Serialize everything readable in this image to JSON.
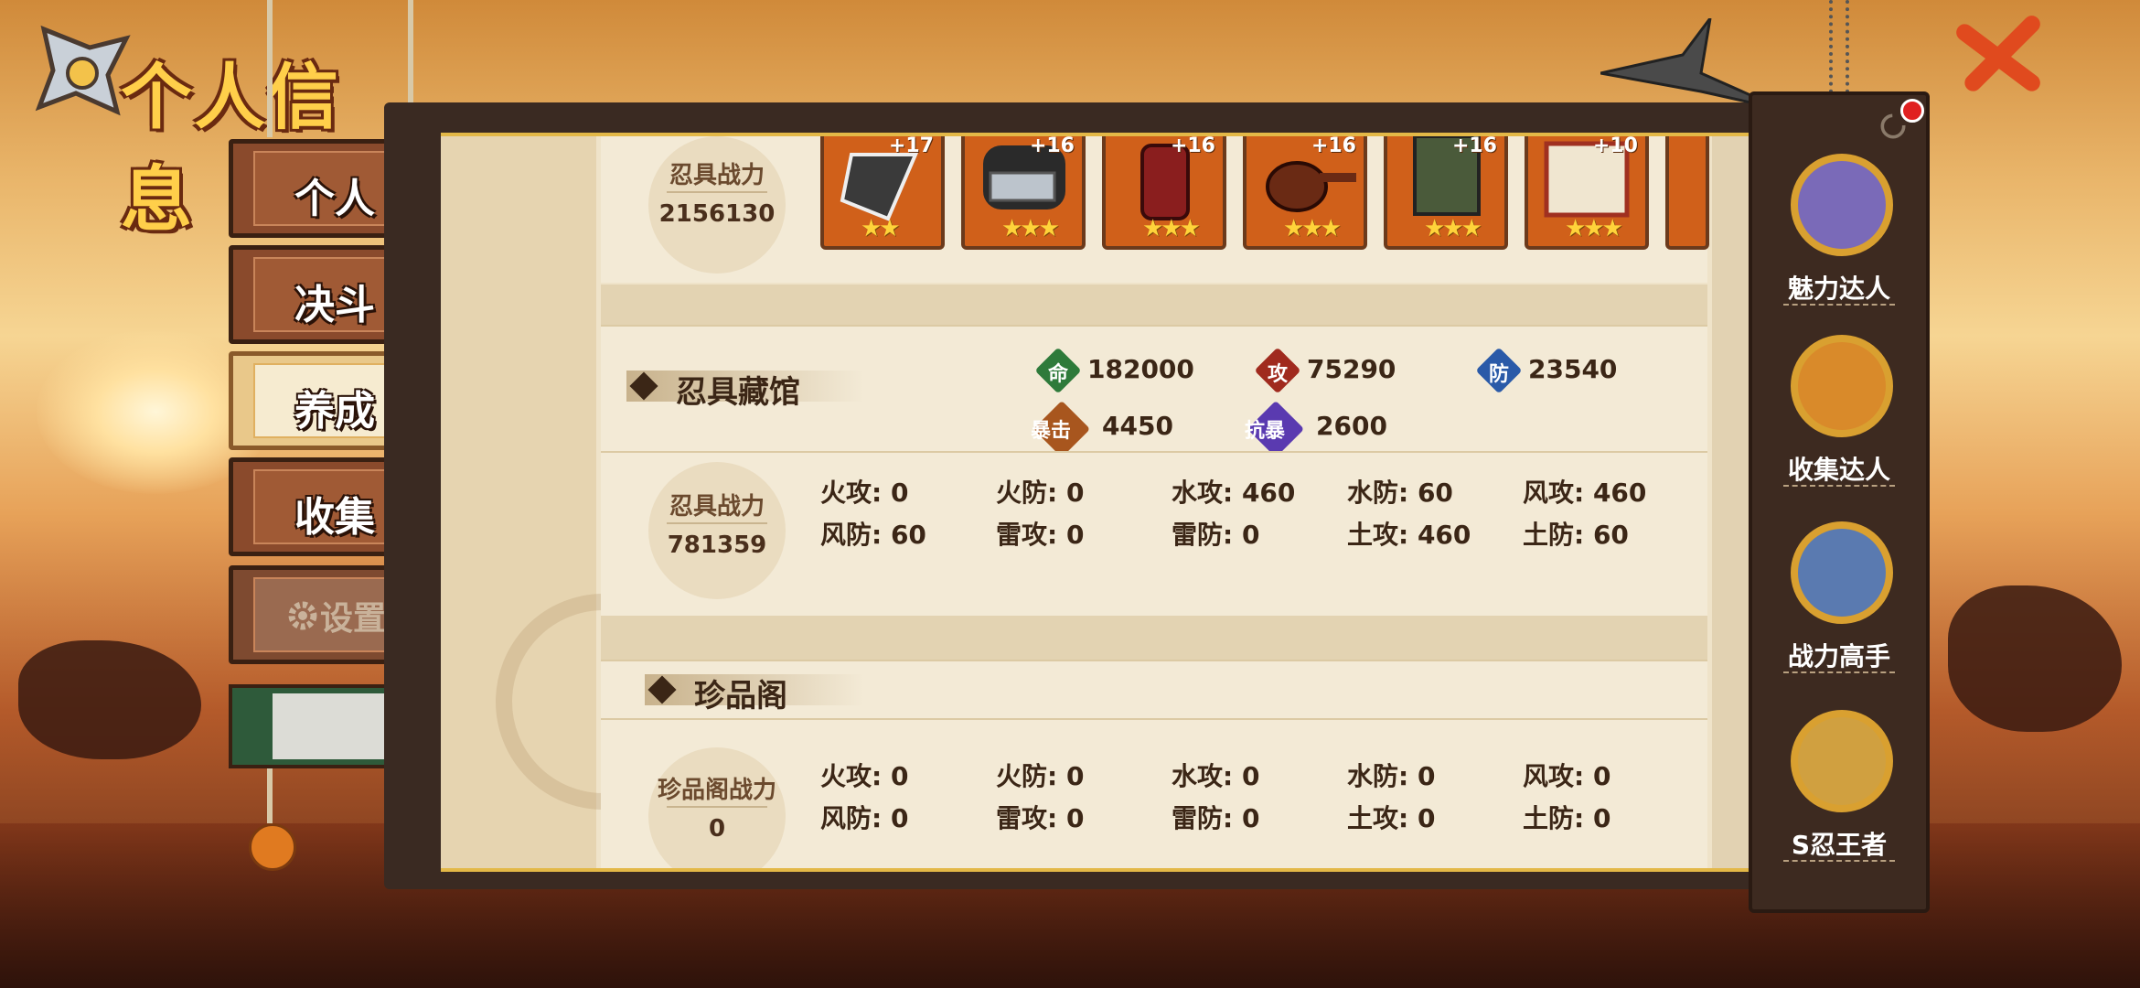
{
  "page_title": "个人信息",
  "tabs": [
    {
      "label": "个人"
    },
    {
      "label": "决斗"
    },
    {
      "label": "养成"
    },
    {
      "label": "收集"
    },
    {
      "label": "设置"
    }
  ],
  "ninja_tools": {
    "power_label": "忍具战力",
    "power_value": "2156130",
    "items": [
      {
        "level": "+17",
        "icon": "blade-icon",
        "stars": "★★"
      },
      {
        "level": "+16",
        "icon": "headband-icon",
        "stars": "★★★"
      },
      {
        "level": "+16",
        "icon": "armor-icon",
        "stars": "★★★"
      },
      {
        "level": "+16",
        "icon": "pipe-icon",
        "stars": "★★★"
      },
      {
        "level": "+16",
        "icon": "vest-icon",
        "stars": "★★★"
      },
      {
        "level": "+10",
        "icon": "scroll-icon",
        "stars": "★★★"
      }
    ]
  },
  "collection": {
    "title": "忍具藏馆",
    "stats": [
      {
        "badge": "命",
        "value": "182000",
        "color": "#2e7a3a"
      },
      {
        "badge": "攻",
        "value": "75290",
        "color": "#a02a1e"
      },
      {
        "badge": "防",
        "value": "23540",
        "color": "#2a5aa8"
      },
      {
        "badge": "暴击",
        "value": "4450",
        "color": "#a8561e"
      },
      {
        "badge": "抗暴",
        "value": "2600",
        "color": "#5a3ab0"
      }
    ],
    "power_label": "忍具战力",
    "power_value": "781359",
    "attrs": [
      "火攻: 0",
      "火防: 0",
      "水攻: 460",
      "水防: 60",
      "风攻: 460",
      "风防: 60",
      "雷攻: 0",
      "雷防: 0",
      "土攻: 460",
      "土防: 60"
    ]
  },
  "treasure": {
    "title": "珍品阁",
    "power_label": "珍品阁战力",
    "power_value": "0",
    "attrs": [
      "火攻: 0",
      "火防: 0",
      "水攻: 0",
      "水防: 0",
      "风攻: 0",
      "风防: 0",
      "雷攻: 0",
      "雷防: 0",
      "土攻: 0",
      "土防: 0"
    ]
  },
  "rankings": [
    {
      "label": "魅力达人",
      "icon": "charm-avatar-icon",
      "color": "#7a6ab8"
    },
    {
      "label": "收集达人",
      "icon": "naruto-avatar-icon",
      "color": "#d98a2a"
    },
    {
      "label": "战力高手",
      "icon": "kakashi-avatar-icon",
      "color": "#5a7ab0"
    },
    {
      "label": "S忍王者",
      "icon": "jiraiya-avatar-icon",
      "color": "#d0a040"
    }
  ]
}
